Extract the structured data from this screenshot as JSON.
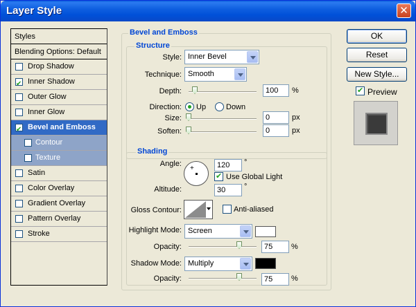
{
  "window": {
    "title": "Layer Style",
    "close_icon": "close-icon"
  },
  "styles_list": {
    "header": "Styles",
    "blending": "Blending Options: Default",
    "items": [
      {
        "label": "Drop Shadow",
        "checked": false
      },
      {
        "label": "Inner Shadow",
        "checked": true
      },
      {
        "label": "Outer Glow",
        "checked": false
      },
      {
        "label": "Inner Glow",
        "checked": false
      },
      {
        "label": "Bevel and Emboss",
        "checked": true,
        "selected": true
      },
      {
        "label": "Contour",
        "checked": false,
        "sub": true
      },
      {
        "label": "Texture",
        "checked": false,
        "sub": true
      },
      {
        "label": "Satin",
        "checked": false
      },
      {
        "label": "Color Overlay",
        "checked": false
      },
      {
        "label": "Gradient Overlay",
        "checked": false
      },
      {
        "label": "Pattern Overlay",
        "checked": false
      },
      {
        "label": "Stroke",
        "checked": false
      }
    ]
  },
  "bevel": {
    "title": "Bevel and Emboss",
    "structure": {
      "title": "Structure",
      "style_label": "Style:",
      "style_value": "Inner Bevel",
      "technique_label": "Technique:",
      "technique_value": "Smooth",
      "depth_label": "Depth:",
      "depth_value": "100",
      "depth_unit": "%",
      "direction_label": "Direction:",
      "up_label": "Up",
      "down_label": "Down",
      "direction_value": "Up",
      "size_label": "Size:",
      "size_value": "0",
      "size_unit": "px",
      "soften_label": "Soften:",
      "soften_value": "0",
      "soften_unit": "px"
    },
    "shading": {
      "title": "Shading",
      "angle_label": "Angle:",
      "angle_value": "120",
      "angle_unit": "°",
      "global_light_label": "Use Global Light",
      "global_light_checked": true,
      "altitude_label": "Altitude:",
      "altitude_value": "30",
      "altitude_unit": "°",
      "gloss_label": "Gloss Contour:",
      "anti_aliased_label": "Anti-aliased",
      "anti_aliased_checked": false,
      "highlight_mode_label": "Highlight Mode:",
      "highlight_mode_value": "Screen",
      "highlight_color": "#ffffff",
      "highlight_opacity_label": "Opacity:",
      "highlight_opacity_value": "75",
      "highlight_opacity_unit": "%",
      "shadow_mode_label": "Shadow Mode:",
      "shadow_mode_value": "Multiply",
      "shadow_color": "#000000",
      "shadow_opacity_label": "Opacity:",
      "shadow_opacity_value": "75",
      "shadow_opacity_unit": "%"
    }
  },
  "actions": {
    "ok": "OK",
    "reset": "Reset",
    "new_style": "New Style...",
    "preview_label": "Preview",
    "preview_checked": true
  },
  "colors": {
    "accent": "#0046d5",
    "selection": "#316ac5",
    "titlebar": "#0050d8"
  }
}
